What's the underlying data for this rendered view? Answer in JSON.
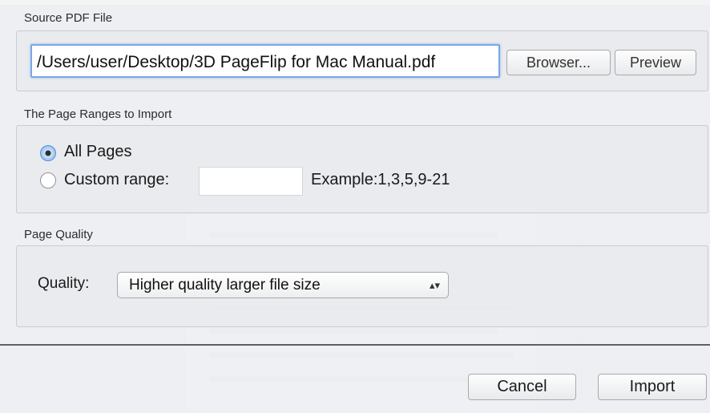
{
  "source": {
    "label": "Source PDF File",
    "path": "/Users/user/Desktop/3D PageFlip  for Mac Manual.pdf",
    "browse_label": "Browser...",
    "preview_label": "Preview"
  },
  "ranges": {
    "label": "The Page Ranges to Import",
    "all_pages_label": "All Pages",
    "custom_label": "Custom range:",
    "custom_value": "",
    "example": "Example:1,3,5,9-21",
    "selected": "All Pages"
  },
  "quality": {
    "label": "Page Quality",
    "field_label": "Quality:",
    "selected": "Higher quality larger file size"
  },
  "footer": {
    "cancel_label": "Cancel",
    "import_label": "Import"
  }
}
